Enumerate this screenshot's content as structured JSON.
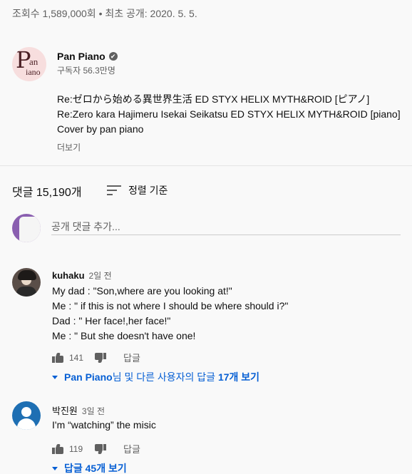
{
  "video": {
    "meta_line": "조회수 1,589,000회 • 최초 공개: 2020. 5. 5."
  },
  "channel": {
    "logo_big": "P",
    "logo_small_1": "an",
    "logo_small_2": "iano",
    "name": "Pan Piano",
    "verified_icon": "✔",
    "subscribers": "구독자 56.3만명"
  },
  "description": {
    "lines": [
      "Re:ゼロから始める異世界生活 ED STYX HELIX MYTH&ROID [ピアノ]",
      "Re:Zero kara Hajimeru Isekai Seikatsu ED STYX HELIX MYTH&ROID [piano]",
      "Cover by pan piano"
    ],
    "more_label": "더보기"
  },
  "comments_header": {
    "count_label": "댓글 15,190개",
    "sort_label": "정렬 기준"
  },
  "add_comment": {
    "placeholder": "공개 댓글 추가..."
  },
  "comments": [
    {
      "author": "kuhaku",
      "time": "2일 전",
      "lines": [
        "My dad : \"Son,where are you looking at!\"",
        "Me : \" if this is not where I should be where should i?\"",
        "Dad : \" Her face!,her face!\"",
        "Me : \" But she doesn't have one!"
      ],
      "likes": "141",
      "reply_label": "답글",
      "replies_bold_1": "Pan Piano",
      "replies_plain": "님 및 다른 사용자의 답글 ",
      "replies_bold_2": "17개 보기"
    },
    {
      "author": "박진원",
      "time": "3일 전",
      "lines": [
        "I'm “watching” the misic"
      ],
      "likes": "119",
      "reply_label": "답글",
      "replies_label": "답글 45개 보기"
    }
  ]
}
